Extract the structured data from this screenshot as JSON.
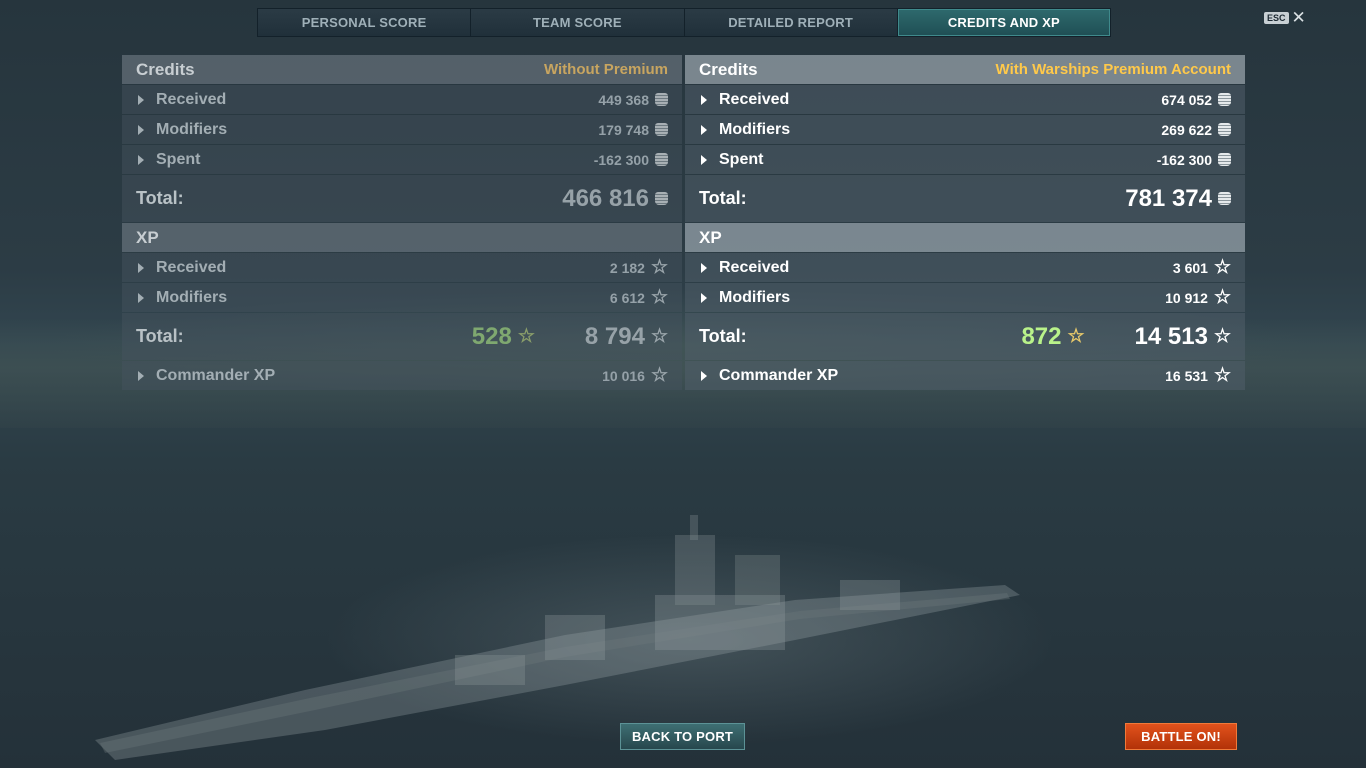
{
  "tabs": [
    {
      "label": "PERSONAL SCORE"
    },
    {
      "label": "TEAM SCORE"
    },
    {
      "label": "DETAILED REPORT"
    },
    {
      "label": "CREDITS AND XP",
      "active": true
    }
  ],
  "esc": {
    "key": "ESC",
    "close": "✕"
  },
  "left": {
    "credits": {
      "title": "Credits",
      "subtitle": "Without Premium",
      "rows": [
        {
          "label": "Received",
          "value": "449 368"
        },
        {
          "label": "Modifiers",
          "value": "179 748"
        },
        {
          "label": "Spent",
          "value": "-162 300"
        }
      ],
      "total_label": "Total:",
      "total_value": "466 816"
    },
    "xp": {
      "title": "XP",
      "rows": [
        {
          "label": "Received",
          "value": "2 182"
        },
        {
          "label": "Modifiers",
          "value": "6 612"
        }
      ],
      "total_label": "Total:",
      "free_xp": "528",
      "total_value": "8 794",
      "commander_label": "Commander XP",
      "commander_value": "10 016"
    }
  },
  "right": {
    "credits": {
      "title": "Credits",
      "subtitle": "With Warships Premium Account",
      "rows": [
        {
          "label": "Received",
          "value": "674 052"
        },
        {
          "label": "Modifiers",
          "value": "269 622"
        },
        {
          "label": "Spent",
          "value": "-162 300"
        }
      ],
      "total_label": "Total:",
      "total_value": "781 374"
    },
    "xp": {
      "title": "XP",
      "rows": [
        {
          "label": "Received",
          "value": "3 601"
        },
        {
          "label": "Modifiers",
          "value": "10 912"
        }
      ],
      "total_label": "Total:",
      "free_xp": "872",
      "total_value": "14 513",
      "commander_label": "Commander XP",
      "commander_value": "16 531"
    }
  },
  "buttons": {
    "back_to_port": "BACK TO PORT",
    "battle_on": "BATTLE ON!"
  },
  "icons": {
    "credit": "credit-coin-icon",
    "xp": "star-icon",
    "expand": "triangle-right-icon"
  },
  "colors": {
    "active_tab": "#2e6a6d",
    "premium_subtitle": "#ffc94a",
    "free_xp_green": "#b9f28a",
    "battle_button": "#d44614"
  }
}
